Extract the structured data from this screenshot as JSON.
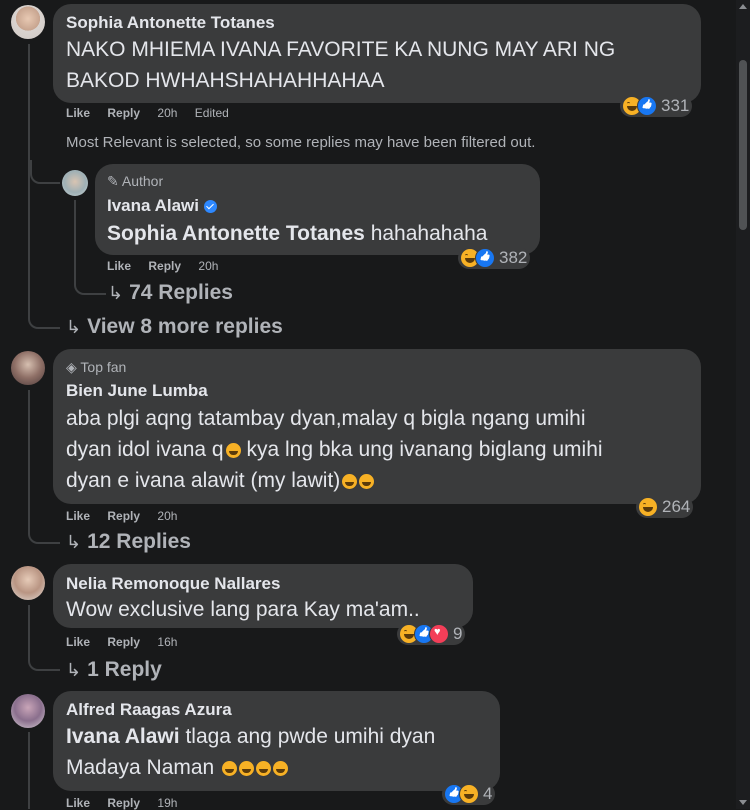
{
  "comments": [
    {
      "name": "Sophia Antonette Totanes",
      "text": "NAKO MHIEMA IVANA FAVORITE KA NUNG MAY ARI NG BAKOD HWHAHSHAHAHHAHAA",
      "actions": {
        "like": "Like",
        "reply": "Reply",
        "time": "20h",
        "edited": "Edited"
      },
      "reaction_icons": [
        "haha-icon",
        "like-icon"
      ],
      "reaction_count": "331",
      "filter_note": "Most Relevant is selected, so some replies may have been filtered out.",
      "reply": {
        "badge": "Author",
        "name": "Ivana Alawi",
        "mention": "Sophia Antonette Totanes",
        "text": "hahahahaha",
        "actions": {
          "like": "Like",
          "reply": "Reply",
          "time": "20h"
        },
        "reaction_icons": [
          "haha-icon",
          "like-icon"
        ],
        "reaction_count": "382",
        "replies_link": "74 Replies"
      },
      "more_replies": "View 8 more replies"
    },
    {
      "badge": "Top fan",
      "name": "Bien June Lumba",
      "text_line1": "aba plgi aqng tatambay dyan,malay q bigla ngang umihi",
      "text_line2": "dyan idol ivana q",
      "text_line2b": " kya lng bka ung ivanang biglang umihi",
      "text_line3": "dyan e ivana alawit (my lawit)",
      "actions": {
        "like": "Like",
        "reply": "Reply",
        "time": "20h"
      },
      "reaction_icons": [
        "haha-icon"
      ],
      "reaction_count": "264",
      "replies_link": "12 Replies"
    },
    {
      "name": "Nelia Remonoque Nallares",
      "text": "Wow exclusive lang para Kay ma'am..",
      "actions": {
        "like": "Like",
        "reply": "Reply",
        "time": "16h"
      },
      "reaction_icons": [
        "haha-icon",
        "like-icon",
        "love-icon"
      ],
      "reaction_count": "9",
      "replies_link": "1 Reply"
    },
    {
      "name": "Alfred Raagas Azura",
      "mention": "Ivana Alawi",
      "text": "tlaga ang pwde umihi dyan",
      "text_line2": "Madaya Naman",
      "actions": {
        "like": "Like",
        "reply": "Reply",
        "time": "19h"
      },
      "reaction_icons": [
        "like-icon",
        "haha-icon"
      ],
      "reaction_count": "4"
    }
  ],
  "colors": {
    "background": "#18191a",
    "bubble": "#3a3b3c",
    "text": "#e4e6eb",
    "secondary": "#b0b3b8",
    "haha": "#f7b125",
    "like": "#1877f2",
    "love": "#f33e58"
  }
}
